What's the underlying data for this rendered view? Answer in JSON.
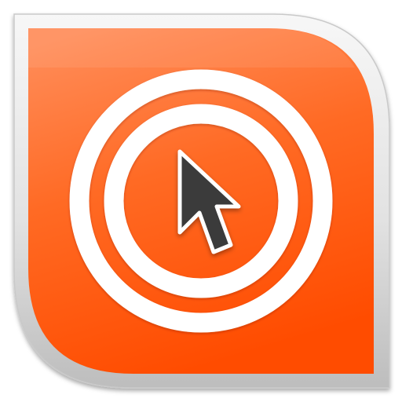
{
  "app_icon": {
    "icon_name": "cursor-target-icon",
    "colors": {
      "frame_light": "#f7f7f7",
      "frame_mid": "#e2e2e2",
      "frame_dark": "#bdbdbd",
      "orange_top": "#ff8d5a",
      "orange_mid": "#ff6a24",
      "orange_bottom": "#ff4c00",
      "rings": "#ffffff",
      "cursor_fill": "#3a3a3a",
      "cursor_outline": "#ffffff"
    }
  }
}
